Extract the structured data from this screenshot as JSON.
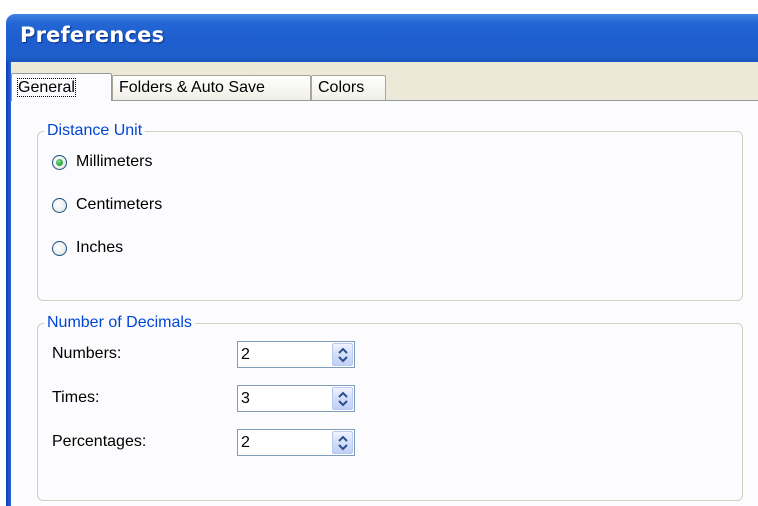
{
  "window": {
    "title": "Preferences"
  },
  "tabs": [
    {
      "label": "General",
      "active": true
    },
    {
      "label": "Folders & Auto Save",
      "active": false
    },
    {
      "label": "Colors",
      "active": false
    }
  ],
  "distance_unit": {
    "legend": "Distance Unit",
    "options": [
      {
        "label": "Millimeters",
        "checked": true
      },
      {
        "label": "Centimeters",
        "checked": false
      },
      {
        "label": "Inches",
        "checked": false
      }
    ]
  },
  "decimals": {
    "legend": "Number of Decimals",
    "fields": [
      {
        "label": "Numbers:",
        "value": "2"
      },
      {
        "label": "Times:",
        "value": "3"
      },
      {
        "label": "Percentages:",
        "value": "2"
      }
    ]
  },
  "icons": {
    "radio_checked": "radio-checked-icon",
    "radio_unchecked": "radio-unchecked-icon",
    "spin": "spin-up-down-icon"
  },
  "colors": {
    "titlebar": "#2466d4",
    "legend_text": "#0046d5",
    "dialog_face": "#ece9d8",
    "page_bg": "#fcfcfe"
  }
}
